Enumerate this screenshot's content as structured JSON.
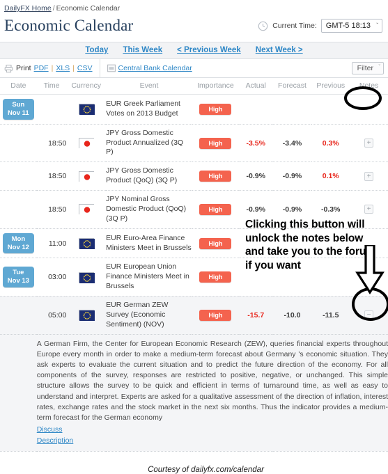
{
  "breadcrumb": {
    "home": "DailyFX Home",
    "separator": "/",
    "current": "Economic Calendar"
  },
  "header": {
    "title": "Economic Calendar",
    "clock_icon": "clock-icon",
    "current_time_label": "Current Time:",
    "current_time_value": "GMT-5 18:13",
    "caret": "ˇ"
  },
  "weeknav": {
    "items": [
      {
        "label": "Today"
      },
      {
        "label": "This Week"
      },
      {
        "label": "< Previous Week"
      },
      {
        "label": "Next Week >"
      }
    ]
  },
  "toolbar": {
    "printer_icon": "printer-icon",
    "print_label": "Print",
    "pdf": "PDF",
    "xls": "XLS",
    "csv": "CSV",
    "pipe": "|",
    "central_bank_icon": "calendar-icon",
    "central_bank_label": "Central Bank Calendar",
    "filter_label": "Filter",
    "filter_caret": "ˇ"
  },
  "table": {
    "columns": [
      "Date",
      "Time",
      "Currency",
      "Event",
      "Importance",
      "Actual",
      "Forecast",
      "Previous",
      "Notes"
    ],
    "rows": [
      {
        "date_day": "Sun",
        "date_num": "Nov 11",
        "time": "",
        "flag": "eu-flag",
        "event": "EUR Greek Parliament Votes on 2013 Budget",
        "importance": "High",
        "actual": "",
        "forecast": "",
        "previous": "",
        "actual_color": "",
        "previous_color": "",
        "note": ""
      },
      {
        "date_day": "",
        "date_num": "",
        "time": "18:50",
        "flag": "jp-flag",
        "event": "JPY Gross Domestic Product Annualized (3Q P)",
        "importance": "High",
        "actual": "-3.5%",
        "forecast": "-3.4%",
        "previous": "0.3%",
        "actual_color": "red",
        "previous_color": "red",
        "note": "+"
      },
      {
        "date_day": "",
        "date_num": "",
        "time": "18:50",
        "flag": "jp-flag",
        "event": "JPY Gross Domestic Product (QoQ) (3Q P)",
        "importance": "High",
        "actual": "-0.9%",
        "forecast": "-0.9%",
        "previous": "0.1%",
        "actual_color": "dark",
        "previous_color": "red",
        "note": "+"
      },
      {
        "date_day": "",
        "date_num": "",
        "time": "18:50",
        "flag": "jp-flag",
        "event": "JPY Nominal Gross Domestic Product (QoQ) (3Q P)",
        "importance": "High",
        "actual": "-0.9%",
        "forecast": "-0.9%",
        "previous": "-0.3%",
        "actual_color": "dark",
        "previous_color": "dark",
        "note": "+"
      },
      {
        "date_day": "Mon",
        "date_num": "Nov 12",
        "time": "11:00",
        "flag": "eu-flag",
        "event": "EUR Euro-Area Finance Ministers Meet in Brussels",
        "importance": "High",
        "actual": "",
        "forecast": "",
        "previous": "",
        "actual_color": "",
        "previous_color": "",
        "note": ""
      },
      {
        "date_day": "Tue",
        "date_num": "Nov 13",
        "time": "03:00",
        "flag": "eu-flag",
        "event": "EUR European Union Finance Ministers Meet in Brussels",
        "importance": "High",
        "actual": "",
        "forecast": "",
        "previous": "",
        "actual_color": "",
        "previous_color": "",
        "note": ""
      },
      {
        "date_day": "",
        "date_num": "",
        "time": "05:00",
        "flag": "eu-flag",
        "event": "EUR German ZEW Survey (Economic Sentiment) (NOV)",
        "importance": "High",
        "actual": "-15.7",
        "forecast": "-10.0",
        "previous": "-11.5",
        "actual_color": "red",
        "previous_color": "dark",
        "note": "−",
        "highlighted": true
      }
    ]
  },
  "description": {
    "text": "A German Firm, the Center for European Economic Research (ZEW), queries financial experts throughout Europe every month in order to make a medium-term forecast about Germany 's economic situation. They ask experts to evaluate the current situation and to predict the future direction of the economy. For all components of the survey, responses are restricted to positive, negative, or unchanged. This simple structure allows the survey to be quick and efficient in terms of turnaround time, as well as easy to understand and interpret. Experts are asked for a qualitative assessment of the direction of inflation, interest rates, exchange rates and the stock market in the next six months. Thus the indicator provides a medium-term forecast for the German economy",
    "discuss_link": "Discuss",
    "description_link": "Description"
  },
  "footer": {
    "caption": "Courtesy of dailyfx.com/calendar"
  },
  "annotation": {
    "text": "Clicking this button will unlock the notes below and take you to the forum if you want",
    "arrow_icon": "down-arrow-annotation",
    "ellipse_notes": "ellipse-around-notes-header",
    "ellipse_button": "ellipse-around-note-button"
  },
  "colors": {
    "accent_blue": "#2e87c6",
    "title_navy": "#27405e",
    "badge_blue": "#5fa8d3",
    "importance_red": "#f4634e",
    "value_red": "#e8261c"
  }
}
